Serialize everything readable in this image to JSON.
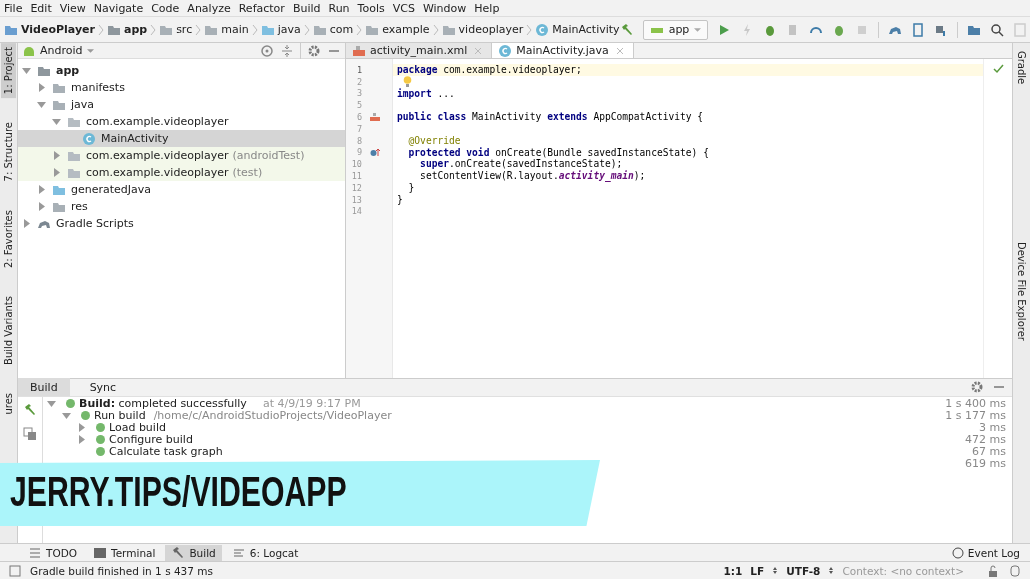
{
  "menu": [
    "File",
    "Edit",
    "View",
    "Navigate",
    "Code",
    "Analyze",
    "Refactor",
    "Build",
    "Run",
    "Tools",
    "VCS",
    "Window",
    "Help"
  ],
  "breadcrumb": [
    {
      "label": "VideoPlayer",
      "kind": "project"
    },
    {
      "label": "app",
      "kind": "module"
    },
    {
      "label": "src",
      "kind": "folder"
    },
    {
      "label": "main",
      "kind": "folder"
    },
    {
      "label": "java",
      "kind": "source"
    },
    {
      "label": "com",
      "kind": "folder"
    },
    {
      "label": "example",
      "kind": "folder"
    },
    {
      "label": "videoplayer",
      "kind": "folder"
    },
    {
      "label": "MainActivity",
      "kind": "class"
    }
  ],
  "run_config": {
    "label": "app"
  },
  "left_strip": [
    {
      "label": "1: Project",
      "selected": true
    },
    {
      "label": "7: Structure",
      "selected": false
    },
    {
      "label": "2: Favorites",
      "selected": false
    },
    {
      "label": "Build Variants",
      "selected": false
    },
    {
      "label": "ures",
      "selected": false
    }
  ],
  "right_strip": [
    {
      "label": "Gradle",
      "selected": false
    },
    {
      "label": "Device File Explorer",
      "selected": false
    }
  ],
  "project_panel": {
    "view": "Android",
    "tree": [
      {
        "label": "app",
        "kind": "module",
        "expanded": true,
        "selected": false,
        "children": [
          {
            "label": "manifests",
            "kind": "folder",
            "expanded": false,
            "selected": false
          },
          {
            "label": "java",
            "kind": "folder",
            "expanded": true,
            "selected": false,
            "children": [
              {
                "label": "com.example.videoplayer",
                "kind": "package",
                "expanded": true,
                "selected": false,
                "children": [
                  {
                    "label": "MainActivity",
                    "kind": "class",
                    "selected": true
                  }
                ]
              },
              {
                "label": "com.example.videoplayer",
                "note": "(androidTest)",
                "kind": "test-package",
                "expanded": false,
                "selected": false
              },
              {
                "label": "com.example.videoplayer",
                "note": "(test)",
                "kind": "test-package",
                "expanded": false,
                "selected": false
              }
            ]
          },
          {
            "label": "generatedJava",
            "kind": "generated",
            "expanded": false,
            "selected": false
          },
          {
            "label": "res",
            "kind": "resources",
            "expanded": false,
            "selected": false
          }
        ]
      },
      {
        "label": "Gradle Scripts",
        "kind": "gradle",
        "expanded": false,
        "selected": false
      }
    ]
  },
  "editor": {
    "tabs": [
      {
        "label": "activity_main.xml",
        "kind": "xml",
        "selected": false
      },
      {
        "label": "MainActivity.java",
        "kind": "class",
        "selected": true
      }
    ],
    "lines": [
      {
        "number": "1",
        "current": true,
        "tokens": [
          {
            "kind": "kw",
            "text": "package"
          },
          {
            "kind": "plain",
            "text": " com.example.videoplayer;"
          }
        ]
      },
      {
        "number": "2",
        "current": false,
        "kind": "bulb"
      },
      {
        "number": "3",
        "current": false,
        "tokens": [
          {
            "kind": "kw",
            "text": "import"
          },
          {
            "kind": "plain",
            "text": " ..."
          }
        ]
      },
      {
        "number": "5",
        "current": false
      },
      {
        "number": "6",
        "current": false,
        "kind": "layout",
        "tokens": [
          {
            "kind": "kw",
            "text": "public class"
          },
          {
            "kind": "plain",
            "text": " MainActivity "
          },
          {
            "kind": "kw",
            "text": "extends"
          },
          {
            "kind": "plain",
            "text": " AppCompatActivity {"
          }
        ]
      },
      {
        "number": "7",
        "current": false
      },
      {
        "number": "8",
        "current": false,
        "tokens": [
          {
            "kind": "ann",
            "text": "  @Override"
          }
        ]
      },
      {
        "number": "9",
        "current": false,
        "kind": "override",
        "tokens": [
          {
            "kind": "kw",
            "text": "  protected void"
          },
          {
            "kind": "plain",
            "text": " onCreate(Bundle savedInstanceState) {"
          }
        ]
      },
      {
        "number": "10",
        "current": false,
        "tokens": [
          {
            "kind": "kw",
            "text": "    super"
          },
          {
            "kind": "plain",
            "text": ".onCreate(savedInstanceState);"
          }
        ]
      },
      {
        "number": "11",
        "current": false,
        "tokens": [
          {
            "kind": "plain",
            "text": "    setContentView(R.layout."
          },
          {
            "kind": "field",
            "text": "activity_main"
          },
          {
            "kind": "plain",
            "text": ");"
          }
        ]
      },
      {
        "number": "12",
        "current": false,
        "tokens": [
          {
            "kind": "plain",
            "text": "  }"
          }
        ]
      },
      {
        "number": "13",
        "current": false,
        "tokens": [
          {
            "kind": "plain",
            "text": "}"
          }
        ]
      },
      {
        "number": "14",
        "current": false
      }
    ]
  },
  "build_panel": {
    "tabs": [
      {
        "label": "Build",
        "selected": true
      },
      {
        "label": "Sync",
        "selected": false
      }
    ],
    "tree": [
      {
        "label": "**Build:** completed successfully",
        "time": "at 4/9/19 9:17 PM",
        "duration": "1 s 400 ms",
        "expanded": true,
        "children": [
          {
            "label": "Run build",
            "path": "/home/c/AndroidStudioProjects/VideoPlayer",
            "duration": "1 s 177 ms",
            "expanded": true,
            "children": [
              {
                "label": "Load build",
                "duration": "3 ms",
                "expanded": false
              },
              {
                "label": "Configure build",
                "duration": "472 ms",
                "expanded": false
              },
              {
                "label": "Calculate task graph",
                "duration": "67 ms"
              },
              {
                "duration": "619 ms"
              }
            ]
          }
        ]
      }
    ]
  },
  "banner": {
    "text": "JERRY.TIPS/VIDEOAPP"
  },
  "tool_tabs": [
    {
      "label": "TODO",
      "kind": "list",
      "selected": false
    },
    {
      "label": "Terminal",
      "kind": "terminal",
      "selected": false
    },
    {
      "label": "Build",
      "kind": "hammer",
      "selected": true
    },
    {
      "label": "6: Logcat",
      "kind": "log",
      "selected": false
    }
  ],
  "event_log": {
    "label": "Event Log"
  },
  "status_bar": {
    "message": "Gradle build finished in 1 s 437 ms",
    "position": "1:1",
    "line_separator": "LF",
    "encoding": "UTF-8",
    "context": "Context: <no context>"
  }
}
